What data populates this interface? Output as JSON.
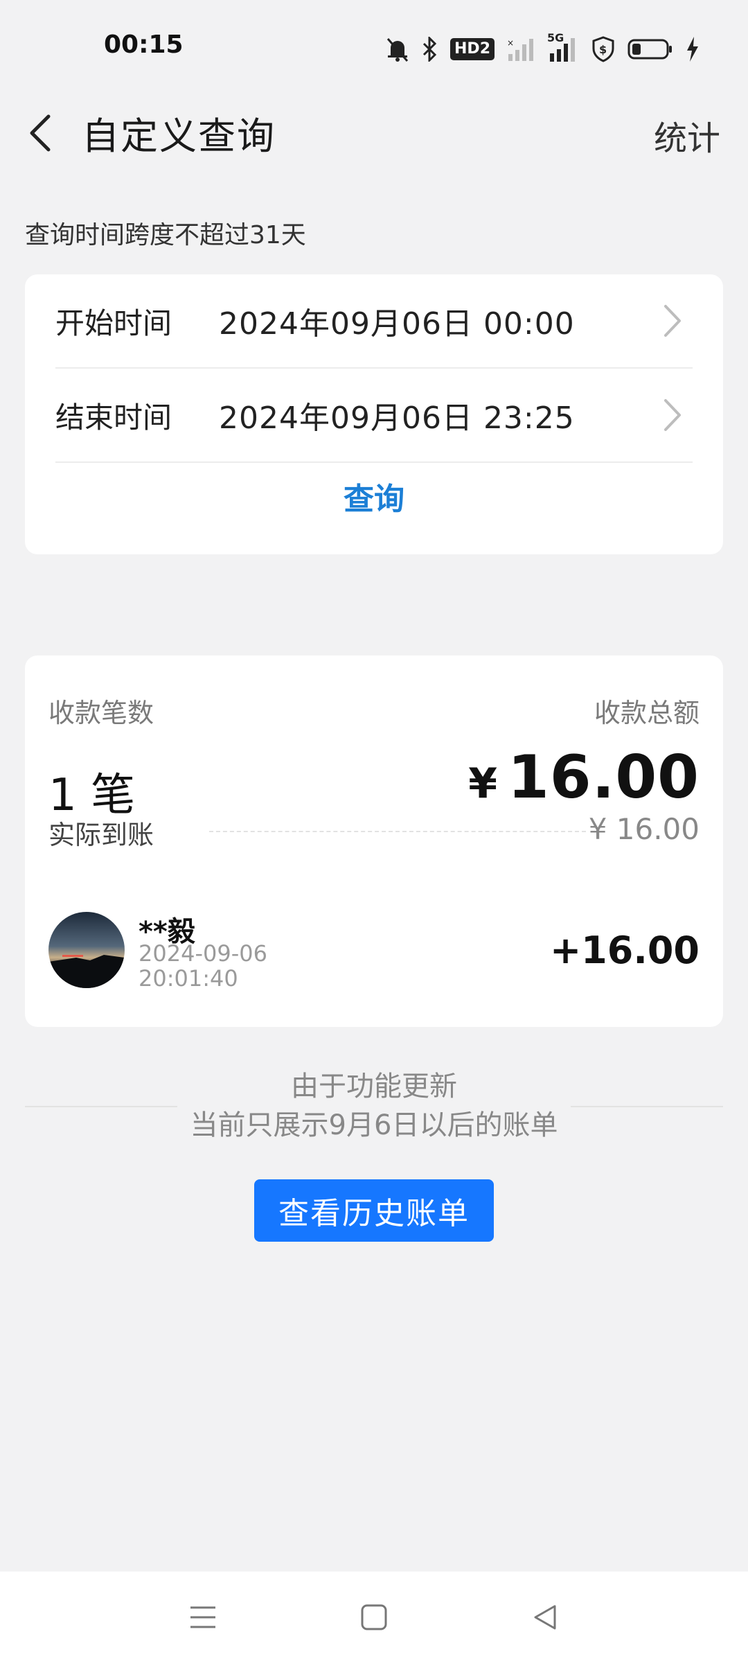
{
  "status_bar": {
    "time": "00:15",
    "icons": [
      "mute-bell-icon",
      "bluetooth-icon",
      "hd-voice-icon",
      "signal-icon",
      "5g-signal-icon",
      "shield-icon",
      "battery-icon",
      "charging-icon"
    ],
    "hd_label": "HD2",
    "network_label": "5G"
  },
  "header": {
    "title": "自定义查询",
    "right_action": "统计"
  },
  "hint": "查询时间跨度不超过31天",
  "query": {
    "start_label": "开始时间",
    "start_value": "2024年09月06日 00:00",
    "end_label": "结束时间",
    "end_value": "2024年09月06日 23:25",
    "button": "查询"
  },
  "summary": {
    "count_label": "收款笔数",
    "total_label": "收款总额",
    "count_value": "1 笔",
    "currency": "¥",
    "total_value": "16.00",
    "arrived_label": "实际到账",
    "arrived_value": "¥ 16.00"
  },
  "transaction": {
    "name": "**毅",
    "date": "2024-09-06",
    "time": "20:01:40",
    "amount": "+16.00"
  },
  "notice": {
    "line1": "由于功能更新",
    "line2": "当前只展示9月6日以后的账单"
  },
  "history_button": "查看历史账单",
  "colors": {
    "accent_blue": "#1677ff",
    "link_blue": "#1c7fd6",
    "background": "#f2f2f3"
  }
}
